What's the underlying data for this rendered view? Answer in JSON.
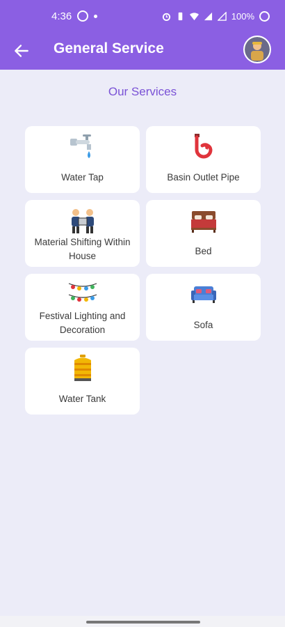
{
  "status_bar": {
    "time": "4:36",
    "battery": "100%"
  },
  "header": {
    "title": "General Service"
  },
  "section_title": "Our Services",
  "services": [
    {
      "label": "Water Tap",
      "icon": "water-tap-icon"
    },
    {
      "label": "Basin Outlet Pipe",
      "icon": "pipe-icon"
    },
    {
      "label": "Material Shifting Within House",
      "icon": "movers-icon"
    },
    {
      "label": "Bed",
      "icon": "bed-icon"
    },
    {
      "label": "Festival Lighting and Decoration",
      "icon": "lights-icon"
    },
    {
      "label": "Sofa",
      "icon": "sofa-icon"
    },
    {
      "label": "Water Tank",
      "icon": "water-tank-icon"
    }
  ],
  "colors": {
    "accent": "#8b5fe3",
    "section_title": "#7a52d6",
    "background": "#ececf8"
  }
}
